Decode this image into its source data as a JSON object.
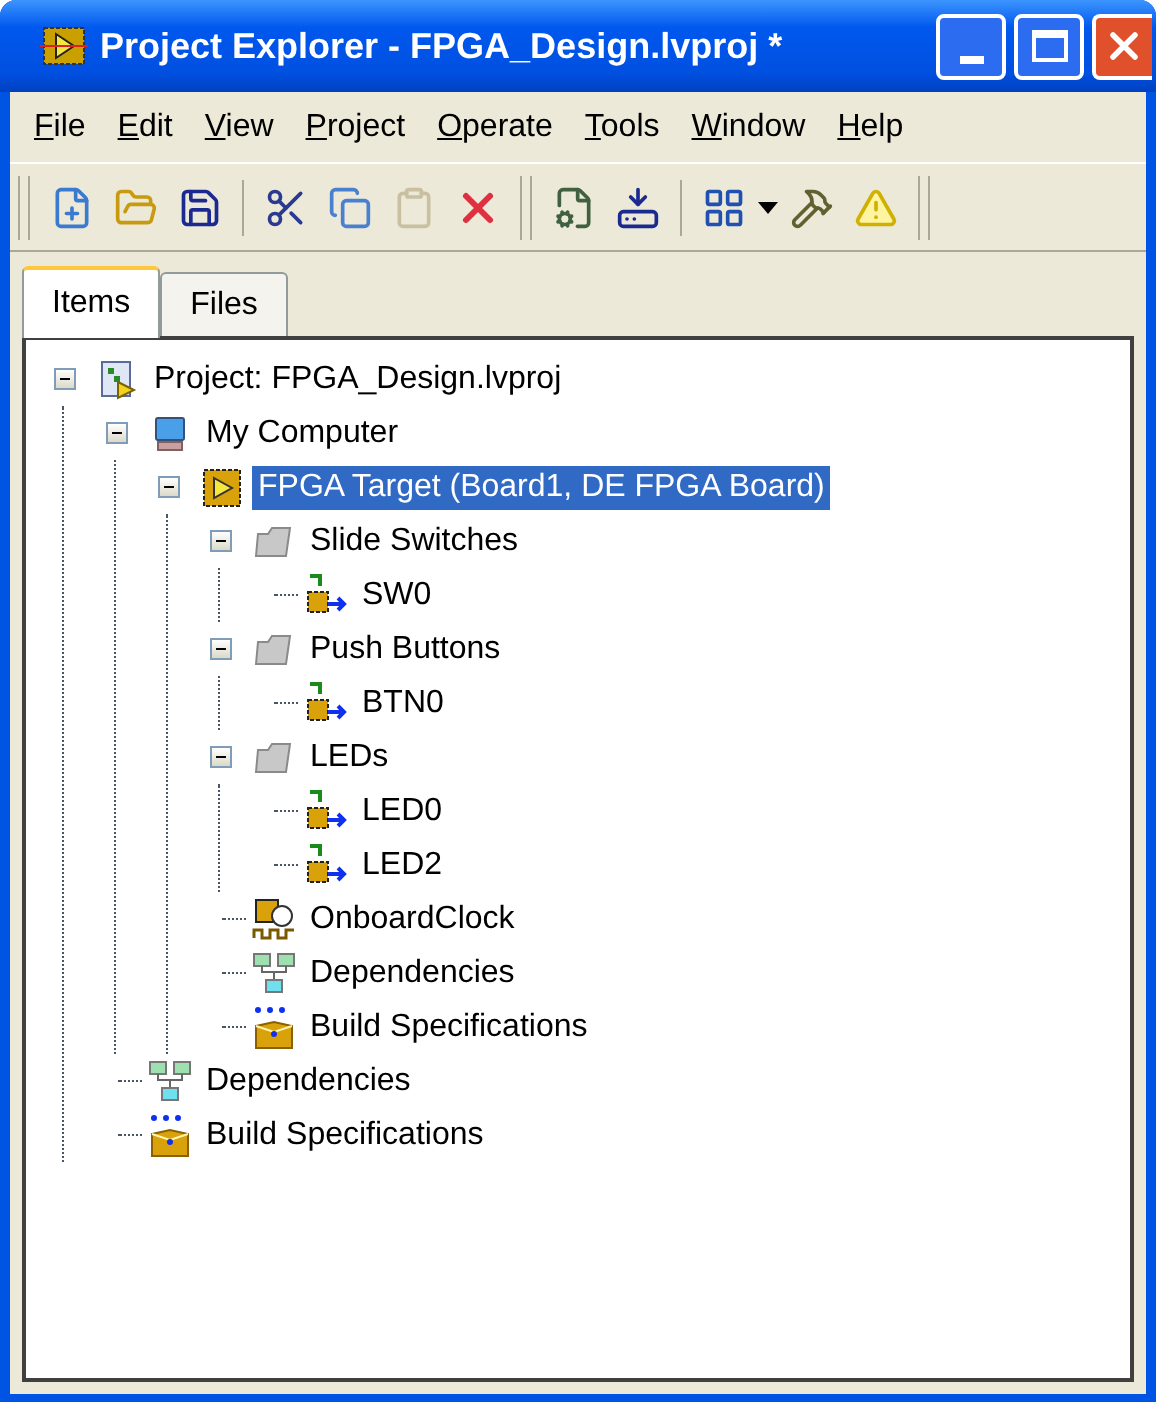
{
  "window": {
    "title": "Project Explorer - FPGA_Design.lvproj *"
  },
  "menu": [
    "File",
    "Edit",
    "View",
    "Project",
    "Operate",
    "Tools",
    "Window",
    "Help"
  ],
  "tabs": [
    {
      "label": "Items",
      "selected": true
    },
    {
      "label": "Files",
      "selected": false
    }
  ],
  "tree": [
    {
      "label": "Project: FPGA_Design.lvproj",
      "kind": "project",
      "selected": false,
      "expanded": true,
      "children": [
        {
          "label": "My Computer",
          "kind": "computer",
          "selected": false,
          "expanded": true,
          "children": [
            {
              "label": "FPGA Target (Board1, DE FPGA Board)",
              "kind": "fpga",
              "selected": true,
              "expanded": true,
              "children": [
                {
                  "label": "Slide Switches",
                  "kind": "folder",
                  "selected": false,
                  "expanded": true,
                  "children": [
                    {
                      "label": "SW0",
                      "kind": "io",
                      "selected": false
                    }
                  ]
                },
                {
                  "label": "Push Buttons",
                  "kind": "folder",
                  "selected": false,
                  "expanded": true,
                  "children": [
                    {
                      "label": "BTN0",
                      "kind": "io",
                      "selected": false
                    }
                  ]
                },
                {
                  "label": "LEDs",
                  "kind": "folder",
                  "selected": false,
                  "expanded": true,
                  "children": [
                    {
                      "label": "LED0",
                      "kind": "io",
                      "selected": false
                    },
                    {
                      "label": "LED2",
                      "kind": "io",
                      "selected": false
                    }
                  ]
                },
                {
                  "label": "OnboardClock",
                  "kind": "clock",
                  "selected": false
                },
                {
                  "label": "Dependencies",
                  "kind": "dependencies",
                  "selected": false
                },
                {
                  "label": "Build Specifications",
                  "kind": "build",
                  "selected": false
                }
              ]
            }
          ]
        },
        {
          "label": "Dependencies",
          "kind": "dependencies",
          "selected": false
        },
        {
          "label": "Build Specifications",
          "kind": "build",
          "selected": false
        }
      ]
    }
  ]
}
